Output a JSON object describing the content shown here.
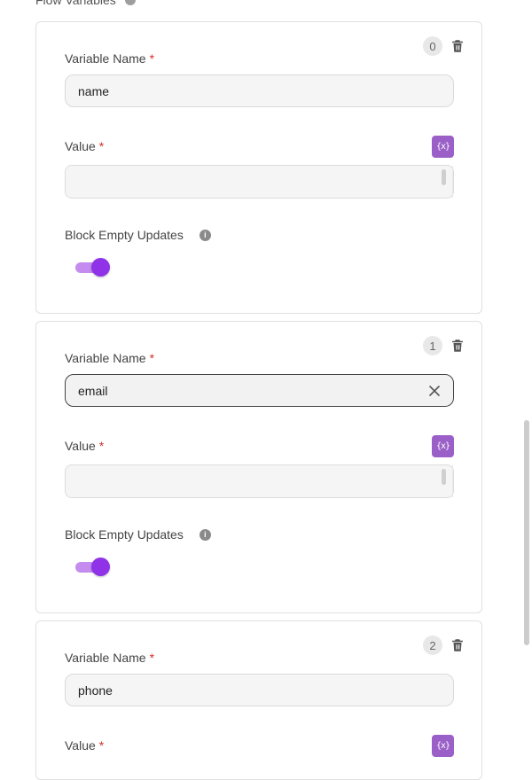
{
  "section": {
    "title": "Flow Variables"
  },
  "cards": [
    {
      "index": "0",
      "name_label": "Variable Name",
      "name_value": "name",
      "value_label": "Value",
      "var_button": "{x}",
      "block_label": "Block Empty Updates",
      "block_empty_updates": true
    },
    {
      "index": "1",
      "name_label": "Variable Name",
      "name_value": "email",
      "value_label": "Value",
      "var_button": "{x}",
      "block_label": "Block Empty Updates",
      "block_empty_updates": true
    },
    {
      "index": "2",
      "name_label": "Variable Name",
      "name_value": "phone",
      "value_label": "Value",
      "var_button": "{x}"
    }
  ],
  "required_mark": "*",
  "info_glyph": "i"
}
